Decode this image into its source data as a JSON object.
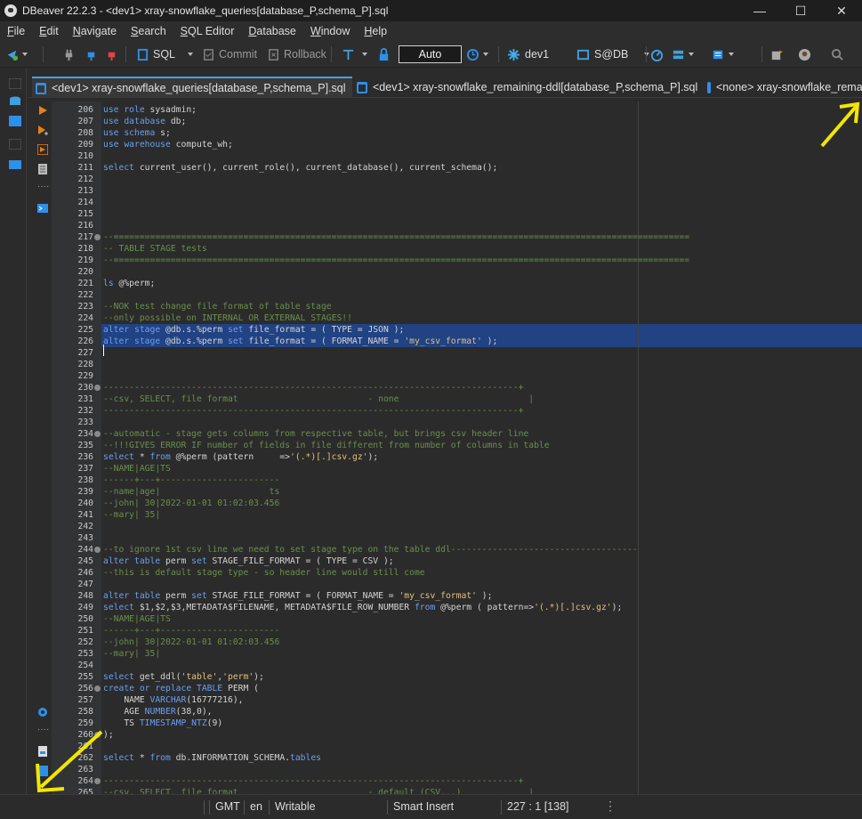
{
  "window": {
    "title": "DBeaver 22.2.3 - <dev1> xray-snowflake_queries[database_P,schema_P].sql",
    "minimize": "—",
    "maximize": "☐",
    "close": "✕"
  },
  "menu": [
    "File",
    "Edit",
    "Navigate",
    "Search",
    "SQL Editor",
    "Database",
    "Window",
    "Help"
  ],
  "toolbar": {
    "sql_label": "SQL",
    "commit_label": "Commit",
    "rollback_label": "Rollback",
    "transaction_mode": "Auto",
    "connection": "dev1",
    "schema": "S@DB"
  },
  "tabs": [
    {
      "label": "<dev1> xray-snowflake_queries[database_P,schema_P].sql",
      "active": true
    },
    {
      "label": "<dev1> xray-snowflake_remaining-ddl[database_P,schema_P].sql",
      "active": false
    },
    {
      "label": "<none> xray-snowflake_rema",
      "active": false
    }
  ],
  "editor": {
    "line_numbers": [
      "206",
      "207",
      "208",
      "209",
      "210",
      "211",
      "212",
      "213",
      "214",
      "215",
      "216",
      "217",
      "218",
      "219",
      "220",
      "221",
      "222",
      "223",
      "224",
      "225",
      "226",
      "227",
      "228",
      "229",
      "230",
      "231",
      "232",
      "233",
      "234",
      "235",
      "236",
      "237",
      "238",
      "239",
      "240",
      "241",
      "242",
      "243",
      "244",
      "245",
      "246",
      "247",
      "248",
      "249",
      "250",
      "251",
      "252",
      "253",
      "254",
      "255",
      "256",
      "257",
      "258",
      "259",
      "260",
      "261",
      "262",
      "263",
      "264",
      "265"
    ],
    "lines": [
      [
        [
          "kw",
          "use role"
        ],
        [
          "",
          "sysadmin;"
        ]
      ],
      [
        [
          "kw",
          "use database"
        ],
        [
          "",
          "db;"
        ]
      ],
      [
        [
          "kw",
          "use schema"
        ],
        [
          "",
          "s;"
        ]
      ],
      [
        [
          "kw",
          "use warehouse"
        ],
        [
          "",
          "compute_wh;"
        ]
      ],
      [],
      [
        [
          "kw",
          "select"
        ],
        [
          "",
          "current_user(), current_role(), current_database(), current_schema();"
        ]
      ],
      [],
      [],
      [],
      [],
      [],
      [
        [
          "cm",
          "--==============================================================================================================="
        ]
      ],
      [
        [
          "cm",
          "-- TABLE STAGE tests"
        ]
      ],
      [
        [
          "cm",
          "--==============================================================================================================="
        ]
      ],
      [],
      [
        [
          "kw",
          "ls"
        ],
        [
          "",
          "@%perm;"
        ]
      ],
      [],
      [
        [
          "cm",
          "--NOK test change file format of table stage"
        ]
      ],
      [
        [
          "cm",
          "--only possible on INTERNAL OR EXTERNAL STAGES!!"
        ]
      ],
      [
        [
          "kw",
          "alter stage"
        ],
        [
          "",
          "@db.s.%perm "
        ],
        [
          "kw",
          "set"
        ],
        [
          "",
          " file_format = ( TYPE = JSON );"
        ]
      ],
      [
        [
          "kw",
          "alter stage"
        ],
        [
          "",
          "@db.s.%perm "
        ],
        [
          "kw",
          "set"
        ],
        [
          "",
          " file_format = ( FORMAT_NAME = "
        ],
        [
          "st",
          "'my_csv_format'"
        ],
        [
          "",
          " );"
        ]
      ],
      [],
      [],
      [],
      [
        [
          "cm",
          "--------------------------------------------------------------------------------+"
        ]
      ],
      [
        [
          "cm",
          "--csv, SELECT, file format                         - none                         |"
        ]
      ],
      [
        [
          "cm",
          "--------------------------------------------------------------------------------+"
        ]
      ],
      [],
      [
        [
          "cm",
          "--automatic - stage gets columns from respective table, but brings csv header line"
        ]
      ],
      [
        [
          "cm",
          "--!!!GIVES ERROR IF number of fields in file different from number of columns in table"
        ]
      ],
      [
        [
          "kw",
          "select"
        ],
        [
          "",
          " * "
        ],
        [
          "kw",
          "from"
        ],
        [
          "",
          " @%perm (pattern     =>"
        ],
        [
          "st",
          "'(.*)[.]csv.gz'"
        ],
        [
          "",
          ");"
        ]
      ],
      [
        [
          "cm",
          "--NAME|AGE|TS"
        ]
      ],
      [
        [
          "cm",
          "------+---+-----------------------"
        ]
      ],
      [
        [
          "cm",
          "--name|age|                     ts"
        ]
      ],
      [
        [
          "cm",
          "--john| 30|2022-01-01 01:02:03.456"
        ]
      ],
      [
        [
          "cm",
          "--mary| 35|"
        ]
      ],
      [],
      [],
      [
        [
          "cm",
          "--to ignore 1st csv line we need to set stage type on the table ddl------------------------------------"
        ]
      ],
      [
        [
          "kw",
          "alter table"
        ],
        [
          "",
          " perm "
        ],
        [
          "kw",
          "set"
        ],
        [
          "",
          " STAGE_FILE_FORMAT = ( TYPE = CSV );"
        ]
      ],
      [
        [
          "cm",
          "--this is default stage type - so header line would still come"
        ]
      ],
      [],
      [
        [
          "kw",
          "alter table"
        ],
        [
          "",
          " perm "
        ],
        [
          "kw",
          "set"
        ],
        [
          "",
          " STAGE_FILE_FORMAT = ( FORMAT_NAME = "
        ],
        [
          "st",
          "'my_csv_format'"
        ],
        [
          "",
          " );"
        ]
      ],
      [
        [
          "kw",
          "select"
        ],
        [
          "",
          " $1,$2,$3,METADATA$FILENAME, METADATA$FILE_ROW_NUMBER "
        ],
        [
          "kw",
          "from"
        ],
        [
          "",
          " @%perm ( pattern=>"
        ],
        [
          "st",
          "'(.*)[.]csv.gz'"
        ],
        [
          "",
          ");"
        ]
      ],
      [
        [
          "cm",
          "--NAME|AGE|TS"
        ]
      ],
      [
        [
          "cm",
          "------+---+-----------------------"
        ]
      ],
      [
        [
          "cm",
          "--john| 30|2022-01-01 01:02:03.456"
        ]
      ],
      [
        [
          "cm",
          "--mary| 35|"
        ]
      ],
      [],
      [
        [
          "kw",
          "select"
        ],
        [
          "",
          " get_ddl("
        ],
        [
          "st",
          "'table'"
        ],
        [
          "",
          ","
        ],
        [
          "st",
          "'perm'"
        ],
        [
          "",
          ");"
        ]
      ],
      [
        [
          "kw",
          "create or replace TABLE"
        ],
        [
          "",
          " PERM ("
        ]
      ],
      [
        [
          "",
          "    NAME "
        ],
        [
          "kw",
          "VARCHAR"
        ],
        [
          "",
          "(16777216),"
        ]
      ],
      [
        [
          "",
          "    AGE "
        ],
        [
          "kw",
          "NUMBER"
        ],
        [
          "",
          "(38,0),"
        ]
      ],
      [
        [
          "",
          "    TS "
        ],
        [
          "kw",
          "TIMESTAMP_NTZ"
        ],
        [
          "",
          "(9)"
        ]
      ],
      [
        [
          "",
          ");"
        ]
      ],
      [],
      [
        [
          "kw",
          "select"
        ],
        [
          "",
          " * "
        ],
        [
          "kw",
          "from"
        ],
        [
          "",
          " db.INFORMATION_SCHEMA."
        ],
        [
          "kw",
          "tables"
        ]
      ],
      [],
      [
        [
          "cm",
          "--------------------------------------------------------------------------------+"
        ]
      ],
      [
        [
          "cm",
          "--csv, SELECT, file format                         - default (CSV...)             |"
        ]
      ]
    ],
    "fold_lines": [
      "217",
      "230",
      "234",
      "244",
      "256",
      "260",
      "264"
    ],
    "highlighted_lines": [
      "225",
      "226"
    ]
  },
  "status": {
    "timezone": "GMT",
    "locale": "en",
    "mode": "Writable",
    "insert_mode": "Smart Insert",
    "cursor": "227 : 1 [138]"
  },
  "colors": {
    "keyword": "#6a9ff0",
    "comment": "#6a8f4a",
    "string": "#e2c07b",
    "selection": "#214283",
    "annotation_arrow": "#f2e600"
  }
}
